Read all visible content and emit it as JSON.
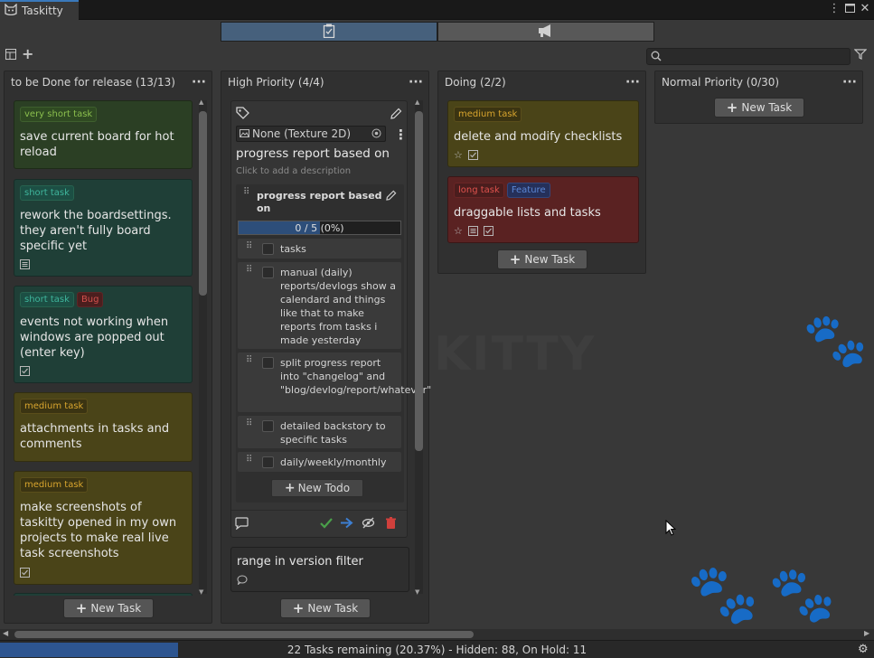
{
  "window": {
    "tab_title": "Taskitty",
    "controls": [
      "kebab-icon",
      "maximize-icon",
      "close-icon"
    ]
  },
  "view_toggle": {
    "options": [
      "board-icon",
      "announcement-icon"
    ],
    "selected": "board-icon"
  },
  "search": {
    "placeholder": "",
    "value": ""
  },
  "columns": [
    {
      "title": "to be Done for release (13/13)",
      "new_task_label": "New Task",
      "cards": [
        {
          "tags": [
            "very short task"
          ],
          "title": "save current board for hot reload",
          "color": "green",
          "icons": []
        },
        {
          "tags": [
            "short task"
          ],
          "title": "rework the boardsettings. they aren't fully board specific yet",
          "color": "teal",
          "icons": [
            "description-icon"
          ]
        },
        {
          "tags": [
            "short task",
            "Bug"
          ],
          "title": "events not working when windows are popped out (enter key)",
          "color": "teal",
          "icons": [
            "checklist-icon"
          ]
        },
        {
          "tags": [
            "medium task"
          ],
          "title": "attachments in tasks and comments",
          "color": "olive",
          "icons": []
        },
        {
          "tags": [
            "medium task"
          ],
          "title": "make screenshots of taskitty opened in my own projects to make real live task screenshots",
          "color": "olive",
          "icons": [
            "checklist-icon"
          ]
        }
      ]
    },
    {
      "title": "High Priority (4/4)",
      "new_task_label": "New Task",
      "expanded_card": {
        "texture_field": "None (Texture 2D)",
        "title": "progress report based on",
        "description_placeholder": "Click to add a description",
        "checklist": {
          "title": "progress report based on",
          "progress_text": "0 / 5 (0%)",
          "progress_fraction": 0.5,
          "todos": [
            "tasks",
            "manual (daily) reports/devlogs show a calendard and things like that to make reports from tasks i made yesterday",
            "split progress report into \"changelog\" and \"blog/devlog/report/whatever\"",
            "detailed backstory to specific tasks",
            "daily/weekly/monthly"
          ],
          "new_todo_label": "New Todo"
        }
      },
      "cards": [
        {
          "tags": [],
          "title": "range in version filter",
          "color": "neutral",
          "icons": [
            "comment-icon"
          ]
        }
      ]
    },
    {
      "title": "Doing (2/2)",
      "new_task_label": "New Task",
      "cards": [
        {
          "tags": [
            "medium task"
          ],
          "title": "delete and modify checklists",
          "color": "olive",
          "icons": [
            "star-icon",
            "checklist-icon"
          ]
        },
        {
          "tags": [
            "long task",
            "Feature"
          ],
          "title": "draggable lists and tasks",
          "color": "red",
          "icons": [
            "star-icon",
            "description-icon",
            "checklist-icon"
          ]
        }
      ]
    },
    {
      "title": "Normal Priority (0/30)",
      "new_task_label": "New Task",
      "cards": []
    }
  ],
  "status": {
    "text": "22 Tasks remaining (20.37%) - Hidden: 88, On Hold: 11",
    "progress_fraction": 0.2037
  },
  "background_watermark": "KITTY",
  "colors": {
    "accent": "#3a79bb",
    "progress": "#2d5590",
    "green_card": "#2b3f24",
    "teal_card": "#1f3f37",
    "olive_card": "#4a4418",
    "red_card": "#5a2222"
  }
}
